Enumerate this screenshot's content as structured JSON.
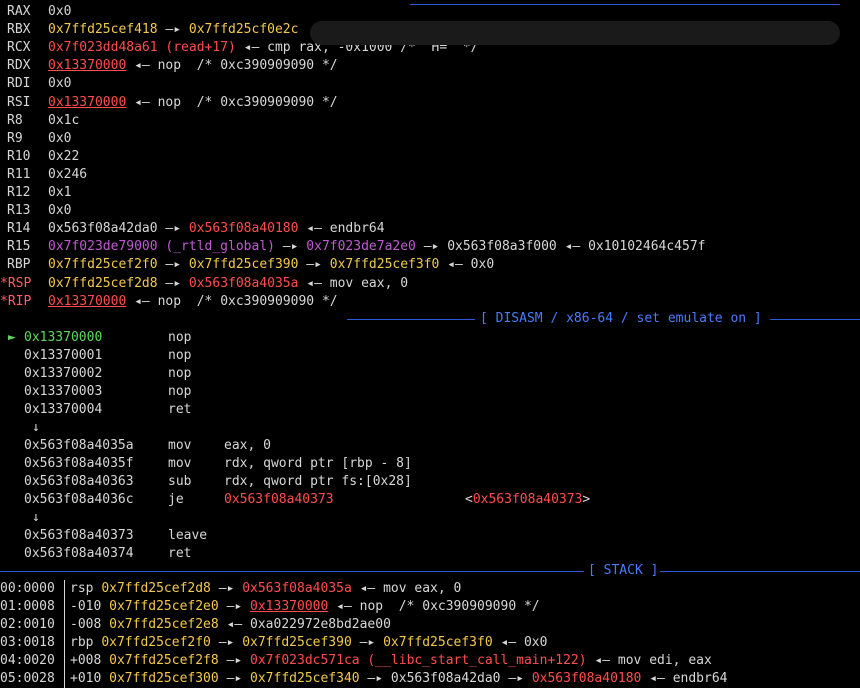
{
  "registers": [
    {
      "name": "RAX",
      "modified": false,
      "parts": [
        {
          "t": "0x0",
          "c": "heap"
        }
      ]
    },
    {
      "name": "RBX",
      "modified": false,
      "parts": [
        {
          "t": "0x7ffd25cef418",
          "c": "stack"
        },
        {
          "t": " —▸ ",
          "c": "arrow"
        },
        {
          "t": "0x7ffd25cf0e2c",
          "c": "stack"
        }
      ]
    },
    {
      "name": "RCX",
      "modified": false,
      "parts": [
        {
          "t": "0x7f023dd48a61 (read+17)",
          "c": "code"
        },
        {
          "t": " ◂— ",
          "c": "arrow"
        },
        {
          "t": "cmp rax, -0x1000 /* 'H=' */",
          "c": "plain"
        }
      ]
    },
    {
      "name": "RDX",
      "modified": false,
      "parts": [
        {
          "t": "0x13370000",
          "c": "code-u"
        },
        {
          "t": " ◂— ",
          "c": "arrow"
        },
        {
          "t": "nop  /* 0xc390909090 */",
          "c": "plain"
        }
      ]
    },
    {
      "name": "RDI",
      "modified": false,
      "parts": [
        {
          "t": "0x0",
          "c": "heap"
        }
      ]
    },
    {
      "name": "RSI",
      "modified": false,
      "parts": [
        {
          "t": "0x13370000",
          "c": "code-u"
        },
        {
          "t": " ◂— ",
          "c": "arrow"
        },
        {
          "t": "nop  /* 0xc390909090 */",
          "c": "plain"
        }
      ]
    },
    {
      "name": "R8",
      "modified": false,
      "parts": [
        {
          "t": "0x1c",
          "c": "heap"
        }
      ]
    },
    {
      "name": "R9",
      "modified": false,
      "parts": [
        {
          "t": "0x0",
          "c": "heap"
        }
      ]
    },
    {
      "name": "R10",
      "modified": false,
      "parts": [
        {
          "t": "0x22",
          "c": "heap"
        }
      ]
    },
    {
      "name": "R11",
      "modified": false,
      "parts": [
        {
          "t": "0x246",
          "c": "heap"
        }
      ]
    },
    {
      "name": "R12",
      "modified": false,
      "parts": [
        {
          "t": "0x1",
          "c": "heap"
        }
      ]
    },
    {
      "name": "R13",
      "modified": false,
      "parts": [
        {
          "t": "0x0",
          "c": "heap"
        }
      ]
    },
    {
      "name": "R14",
      "modified": false,
      "parts": [
        {
          "t": "0x563f08a42da0",
          "c": "heap"
        },
        {
          "t": " —▸ ",
          "c": "arrow"
        },
        {
          "t": "0x563f08a40180",
          "c": "code"
        },
        {
          "t": " ◂— ",
          "c": "arrow"
        },
        {
          "t": "endbr64",
          "c": "plain"
        }
      ]
    },
    {
      "name": "R15",
      "modified": false,
      "parts": [
        {
          "t": "0x7f023de79000 (_rtld_global)",
          "c": "lib"
        },
        {
          "t": " —▸ ",
          "c": "arrow"
        },
        {
          "t": "0x7f023de7a2e0",
          "c": "lib"
        },
        {
          "t": " —▸ ",
          "c": "arrow"
        },
        {
          "t": "0x563f08a3f000",
          "c": "heap"
        },
        {
          "t": " ◂— ",
          "c": "arrow"
        },
        {
          "t": "0x10102464c457f",
          "c": "plain"
        }
      ]
    },
    {
      "name": "RBP",
      "modified": false,
      "parts": [
        {
          "t": "0x7ffd25cef2f0",
          "c": "stack"
        },
        {
          "t": " —▸ ",
          "c": "arrow"
        },
        {
          "t": "0x7ffd25cef390",
          "c": "stack"
        },
        {
          "t": " —▸ ",
          "c": "arrow"
        },
        {
          "t": "0x7ffd25cef3f0",
          "c": "stack"
        },
        {
          "t": " ◂— ",
          "c": "arrow"
        },
        {
          "t": "0x0",
          "c": "plain"
        }
      ]
    },
    {
      "name": "*RSP",
      "modified": true,
      "parts": [
        {
          "t": "0x7ffd25cef2d8",
          "c": "stack"
        },
        {
          "t": " —▸ ",
          "c": "arrow"
        },
        {
          "t": "0x563f08a4035a",
          "c": "code"
        },
        {
          "t": " ◂— ",
          "c": "arrow"
        },
        {
          "t": "mov eax, 0",
          "c": "plain"
        }
      ]
    },
    {
      "name": "*RIP",
      "modified": true,
      "parts": [
        {
          "t": "0x13370000",
          "c": "code-u"
        },
        {
          "t": " ◂— ",
          "c": "arrow"
        },
        {
          "t": "nop  /* 0xc390909090 */",
          "c": "plain"
        }
      ]
    }
  ],
  "disasm_header": "[ DISASM / x86-64 / set emulate on ]",
  "disasm": [
    {
      "current": true,
      "addr": "0x13370000",
      "mn": "nop",
      "ops": ""
    },
    {
      "addr": "0x13370001",
      "mn": "nop",
      "ops": ""
    },
    {
      "addr": "0x13370002",
      "mn": "nop",
      "ops": ""
    },
    {
      "addr": "0x13370003",
      "mn": "nop",
      "ops": ""
    },
    {
      "addr": "0x13370004",
      "mn": "ret",
      "ops": ""
    },
    {
      "jump": true
    },
    {
      "addr": "0x563f08a4035a",
      "mn": "mov",
      "ops": "eax, 0"
    },
    {
      "addr": "0x563f08a4035f",
      "mn": "mov",
      "ops": "rdx, qword ptr [rbp - 8]"
    },
    {
      "addr": "0x563f08a40363",
      "mn": "sub",
      "ops": "rdx, qword ptr fs:[0x28]"
    },
    {
      "addr": "0x563f08a4036c",
      "mn": "je",
      "ops": "0x563f08a40373",
      "ops_color": "code",
      "target": "<0x563f08a40373>"
    },
    {
      "jump": true
    },
    {
      "addr": "0x563f08a40373",
      "mn": "leave",
      "ops": ""
    },
    {
      "addr": "0x563f08a40374",
      "mn": "ret",
      "ops": ""
    }
  ],
  "stack_header": "[ STACK ]",
  "stack": [
    {
      "idx": "00:0000",
      "parts": [
        {
          "t": "rsp ",
          "c": "plain"
        },
        {
          "t": "0x7ffd25cef2d8",
          "c": "stack"
        },
        {
          "t": " —▸ ",
          "c": "arrow"
        },
        {
          "t": "0x563f08a4035a",
          "c": "code"
        },
        {
          "t": " ◂— ",
          "c": "arrow"
        },
        {
          "t": "mov eax, 0",
          "c": "plain"
        }
      ]
    },
    {
      "idx": "01:0008",
      "parts": [
        {
          "t": "-010 ",
          "c": "plain"
        },
        {
          "t": "0x7ffd25cef2e0",
          "c": "stack"
        },
        {
          "t": " —▸ ",
          "c": "arrow"
        },
        {
          "t": "0x13370000",
          "c": "code-u"
        },
        {
          "t": " ◂— ",
          "c": "arrow"
        },
        {
          "t": "nop  /* 0xc390909090 */",
          "c": "plain"
        }
      ]
    },
    {
      "idx": "02:0010",
      "parts": [
        {
          "t": "-008 ",
          "c": "plain"
        },
        {
          "t": "0x7ffd25cef2e8",
          "c": "stack"
        },
        {
          "t": " ◂— ",
          "c": "arrow"
        },
        {
          "t": "0xa022972e8bd2ae00",
          "c": "plain"
        }
      ]
    },
    {
      "idx": "03:0018",
      "parts": [
        {
          "t": "rbp ",
          "c": "plain"
        },
        {
          "t": "0x7ffd25cef2f0",
          "c": "stack"
        },
        {
          "t": " —▸ ",
          "c": "arrow"
        },
        {
          "t": "0x7ffd25cef390",
          "c": "stack"
        },
        {
          "t": " —▸ ",
          "c": "arrow"
        },
        {
          "t": "0x7ffd25cef3f0",
          "c": "stack"
        },
        {
          "t": " ◂— ",
          "c": "arrow"
        },
        {
          "t": "0x0",
          "c": "plain"
        }
      ]
    },
    {
      "idx": "04:0020",
      "parts": [
        {
          "t": "+008 ",
          "c": "plain"
        },
        {
          "t": "0x7ffd25cef2f8",
          "c": "stack"
        },
        {
          "t": " —▸ ",
          "c": "arrow"
        },
        {
          "t": "0x7f023dc571ca (__libc_start_call_main+122)",
          "c": "code"
        },
        {
          "t": " ◂— ",
          "c": "arrow"
        },
        {
          "t": "mov edi, eax",
          "c": "plain"
        }
      ]
    },
    {
      "idx": "05:0028",
      "parts": [
        {
          "t": "+010 ",
          "c": "plain"
        },
        {
          "t": "0x7ffd25cef300",
          "c": "stack"
        },
        {
          "t": " —▸ ",
          "c": "arrow"
        },
        {
          "t": "0x7ffd25cef340",
          "c": "stack"
        },
        {
          "t": " —▸ ",
          "c": "arrow"
        },
        {
          "t": "0x563f08a42da0",
          "c": "heap"
        },
        {
          "t": " —▸ ",
          "c": "arrow"
        },
        {
          "t": "0x563f08a40180",
          "c": "code"
        },
        {
          "t": " ◂— ",
          "c": "arrow"
        },
        {
          "t": "endbr64",
          "c": "plain"
        }
      ]
    }
  ],
  "colors": {
    "stack": "#f3c94b",
    "code": "#ff4d4d",
    "lib": "#c05ad3",
    "heap": "#d7d7d7",
    "current": "#5fd75f",
    "rule": "#2a5bd7",
    "title": "#4a7bff"
  }
}
